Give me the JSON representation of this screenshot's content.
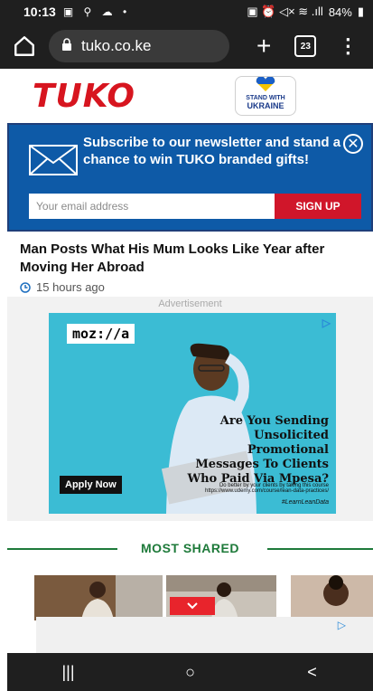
{
  "status_bar": {
    "time": "10:13",
    "left_icons": "▣ ⚲ ☁ •",
    "right_icons": "▣ ⏰ ◁× ≋ .ıll",
    "battery": "84%"
  },
  "browser": {
    "url": "tuko.co.ke",
    "tab_count": "23",
    "menu": "⋮"
  },
  "site": {
    "logo": "TUKO",
    "ukraine_top": "STAND WITH",
    "ukraine_bottom": "UKRAINE"
  },
  "newsletter": {
    "title": "Subscribe to our newsletter and stand a chance to win TUKO branded gifts!",
    "email_placeholder": "Your email address",
    "signup_label": "SIGN UP",
    "close": "✕"
  },
  "article": {
    "headline": "Man Posts What His Mum Looks Like Year after Moving Her Abroad",
    "time": "15 hours ago"
  },
  "ad": {
    "label": "Advertisement",
    "brand": "moz://a",
    "headline": "Are You Sending Unsolicited Promotional Messages To Clients Who Paid Via Mpesa?",
    "apply": "Apply Now",
    "small_text": "Do better by your clients by taking this course https://www.udemy.com/course/lean-data-practices/",
    "hashtag": "#LearnLeanData"
  },
  "most_shared": {
    "label": "MOST SHARED"
  },
  "colors": {
    "tuko_red": "#d7151f",
    "newsletter_blue": "#0e5aa7",
    "signup_red": "#d0162a",
    "most_shared_green": "#1e7a3a",
    "ad_cyan": "#3bbcd4"
  },
  "nav": {
    "recents": "|||",
    "home": "○",
    "back": "<"
  }
}
